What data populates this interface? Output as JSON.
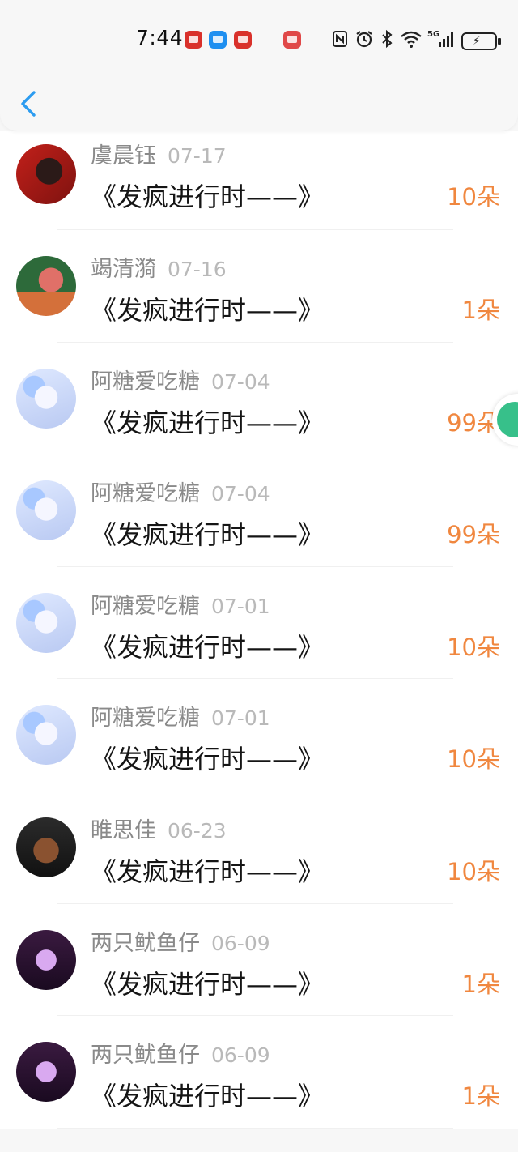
{
  "status_bar": {
    "time": "7:44",
    "network": "5G"
  },
  "header": {
    "back_icon": "chevron-left-icon",
    "accent_color": "#2c9cf0"
  },
  "records": [
    {
      "name": "虞晨钰",
      "date": "07-17",
      "title": "《发疯进行时——》",
      "amount": "10朵",
      "avatar": "avatar-red-portrait"
    },
    {
      "name": "竭清漪",
      "date": "07-16",
      "title": "《发疯进行时——》",
      "amount": "1朵",
      "avatar": "avatar-cartoon-green"
    },
    {
      "name": "阿糖爱吃糖",
      "date": "07-04",
      "title": "《发疯进行时——》",
      "amount": "99朵",
      "avatar": "avatar-anime-blue"
    },
    {
      "name": "阿糖爱吃糖",
      "date": "07-04",
      "title": "《发疯进行时——》",
      "amount": "99朵",
      "avatar": "avatar-anime-blue"
    },
    {
      "name": "阿糖爱吃糖",
      "date": "07-01",
      "title": "《发疯进行时——》",
      "amount": "10朵",
      "avatar": "avatar-anime-blue"
    },
    {
      "name": "阿糖爱吃糖",
      "date": "07-01",
      "title": "《发疯进行时——》",
      "amount": "10朵",
      "avatar": "avatar-anime-blue"
    },
    {
      "name": "睢思佳",
      "date": "06-23",
      "title": "《发疯进行时——》",
      "amount": "10朵",
      "avatar": "avatar-gym-photo"
    },
    {
      "name": "两只鱿鱼仔",
      "date": "06-09",
      "title": "《发疯进行时——》",
      "amount": "1朵",
      "avatar": "avatar-purple-lotus"
    },
    {
      "name": "两只鱿鱼仔",
      "date": "06-09",
      "title": "《发疯进行时——》",
      "amount": "1朵",
      "avatar": "avatar-purple-lotus"
    }
  ],
  "colors": {
    "amount": "#f0873f",
    "name": "#8a8a8a",
    "date": "#b9b9b9",
    "title": "#151515",
    "float_button": "#37c08a"
  }
}
